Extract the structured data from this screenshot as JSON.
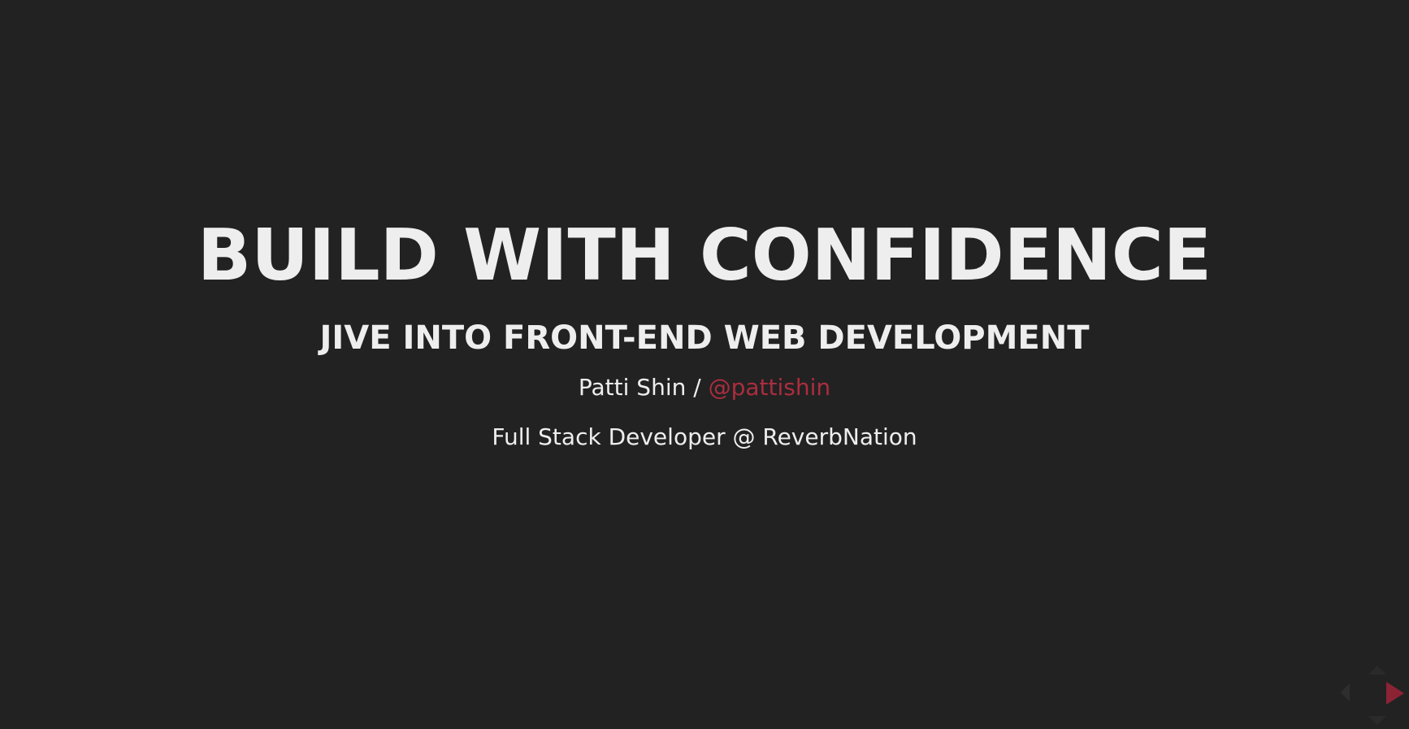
{
  "slide": {
    "title": "BUILD WITH CONFIDENCE",
    "subtitle": "JIVE INTO FRONT-END WEB DEVELOPMENT",
    "author_name": "Patti Shin / ",
    "author_handle": "@pattishin",
    "role": "Full Stack Developer @ ReverbNation"
  },
  "controls": {
    "up_icon": "triangle-up-icon",
    "down_icon": "triangle-down-icon",
    "left_icon": "triangle-left-icon",
    "right_icon": "triangle-right-icon"
  },
  "colors": {
    "background": "#222222",
    "text": "#eeeeee",
    "accent": "#ab2d3f"
  }
}
